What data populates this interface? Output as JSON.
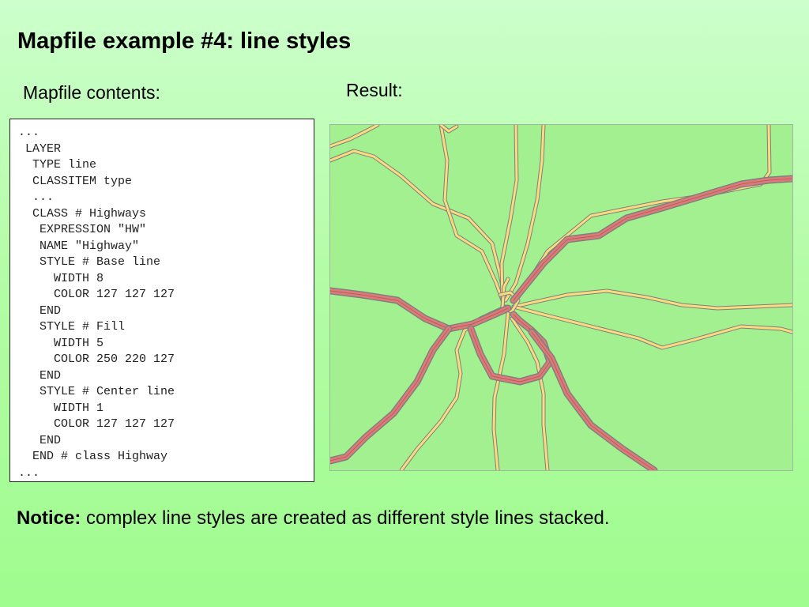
{
  "slide": {
    "title": "Mapfile example #4: line styles",
    "left_label": "Mapfile contents:",
    "right_label": "Result:"
  },
  "mapfile": {
    "lines": [
      "...",
      " LAYER",
      "  TYPE line",
      "  CLASSITEM type",
      "  ...",
      "  CLASS # Highways",
      "   EXPRESSION \"HW\"",
      "   NAME \"Highway\"",
      "   STYLE # Base line",
      "     WIDTH 8",
      "     COLOR 127 127 127",
      "   END",
      "   STYLE # Fill",
      "     WIDTH 5",
      "     COLOR 250 220 127",
      "   END",
      "   STYLE # Center line",
      "     WIDTH 1",
      "     COLOR 127 127 127",
      "   END",
      "  END # class Highway",
      "..."
    ]
  },
  "map": {
    "background_color": "#a2f08f",
    "base_line_color": "#7f7f7f",
    "fill_color": "#fadc7f",
    "center_line_color": "#7f7f7f",
    "highway_fill_color": "#e07a78",
    "highway_center_color": "#b06060"
  },
  "notice": {
    "label": "Notice:",
    "text": " complex line styles are created as different style lines stacked."
  }
}
